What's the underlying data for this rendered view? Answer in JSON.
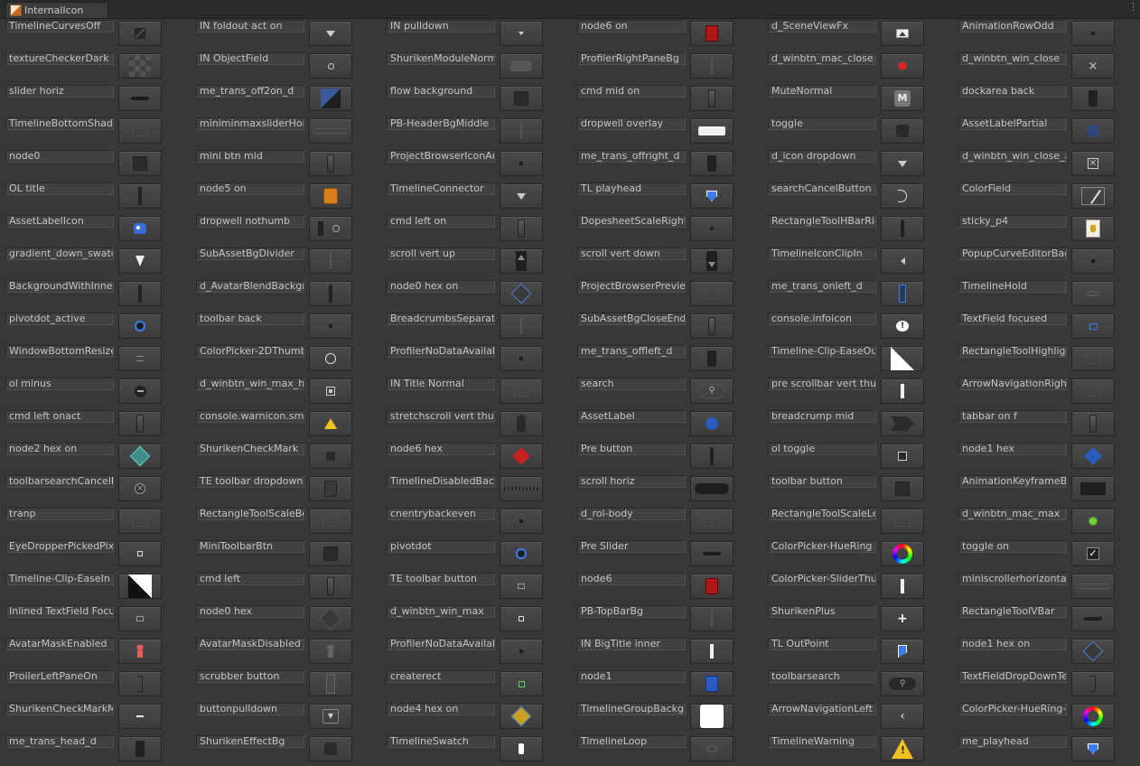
{
  "window": {
    "tab_label": "InternalIcon"
  },
  "grid": {
    "columns": [
      {
        "cells": [
          {
            "label": "TimelineCurvesOff",
            "icon": "curves-off-icon"
          },
          {
            "label": "textureCheckerDark",
            "icon": "checker-icon"
          },
          {
            "label": "slider horiz",
            "icon": "slider-horiz-icon"
          },
          {
            "label": "TimelineBottomShadow",
            "icon": "faint-icon"
          },
          {
            "label": "node0",
            "icon": "dark-square-icon"
          },
          {
            "label": "OL title",
            "icon": "thin-bar-icon"
          },
          {
            "label": "AssetLabelIcon",
            "icon": "tag-icon"
          },
          {
            "label": "gradient_down_swatch",
            "icon": "swatch-down-icon"
          },
          {
            "label": "BackgroundWithInnerShadow",
            "icon": "thin-bar-icon"
          },
          {
            "label": "pivotdot_active",
            "icon": "blue-circle-icon"
          },
          {
            "label": "WindowBottomResize",
            "icon": "resize-icon"
          },
          {
            "label": "ol minus",
            "icon": "minus-circle-icon"
          },
          {
            "label": "cmd left onact",
            "icon": "cmd-icon"
          },
          {
            "label": "node2 hex on",
            "icon": "teal-hex-icon"
          },
          {
            "label": "toolbarsearchCancelButton",
            "icon": "cancel-circle-icon"
          },
          {
            "label": "tranp",
            "icon": "faint-icon"
          },
          {
            "label": "EyeDropperPickedPixel",
            "icon": "small-square-outline-icon"
          },
          {
            "label": "Timeline-Clip-EaseIn",
            "icon": "ease-in-icon"
          },
          {
            "label": "Inlined TextField Focus",
            "icon": "small-rect-icon"
          },
          {
            "label": "AvatarMaskEnabled",
            "icon": "avatar-red-icon"
          },
          {
            "label": "ProilerLeftPaneOn",
            "icon": "bracket-icon"
          },
          {
            "label": "ShurikenCheckMarkMixed",
            "icon": "check-mixed-icon"
          },
          {
            "label": "me_trans_head_d",
            "icon": "dark-bar-icon"
          }
        ]
      },
      {
        "cells": [
          {
            "label": "IN foldout act on",
            "icon": "triangle-down-icon"
          },
          {
            "label": "IN ObjectField",
            "icon": "target-icon"
          },
          {
            "label": "me_trans_off2on_d",
            "icon": "trans-blue-icon"
          },
          {
            "label": "miniminmaxsliderHorizontal",
            "icon": "minmax-icon"
          },
          {
            "label": "mini btn mid",
            "icon": "cmd-icon"
          },
          {
            "label": "node5 on",
            "icon": "orange-node-icon"
          },
          {
            "label": "dropwell nothumb",
            "icon": "dropwell-icon"
          },
          {
            "label": "SubAssetBgDivider",
            "icon": "divider-icon"
          },
          {
            "label": "d_AvatarBlendBackground",
            "icon": "thin-bar-icon"
          },
          {
            "label": "toolbar back",
            "icon": "tiny-dot-icon"
          },
          {
            "label": "ColorPicker-2DThumb",
            "icon": "ring-icon"
          },
          {
            "label": "d_winbtn_win_max_h",
            "icon": "win-max-icon"
          },
          {
            "label": "console.warnicon.sml",
            "icon": "warning-small-icon"
          },
          {
            "label": "ShurikenCheckMark",
            "icon": "dark-dot-icon"
          },
          {
            "label": "TE toolbar dropdown",
            "icon": "dropdown-small-icon"
          },
          {
            "label": "RectangleToolScaleBottom",
            "icon": "faint-icon"
          },
          {
            "label": "MiniToolbarBtn",
            "icon": "dark-square-icon"
          },
          {
            "label": "cmd left",
            "icon": "cmd-icon"
          },
          {
            "label": "node0 hex",
            "icon": "grey-hex-icon"
          },
          {
            "label": "AvatarMaskDisabled",
            "icon": "avatar-grey-icon"
          },
          {
            "label": "scrubber button",
            "icon": "scrubber-icon"
          },
          {
            "label": "buttonpulldown",
            "icon": "pulldown-icon"
          },
          {
            "label": "ShurikenEffectBg",
            "icon": "dark-rounded-icon"
          }
        ]
      },
      {
        "cells": [
          {
            "label": "IN pulldown",
            "icon": "small-triangle-icon"
          },
          {
            "label": "ShurikenModuleNormal",
            "icon": "module-icon"
          },
          {
            "label": "flow background",
            "icon": "dark-square-icon"
          },
          {
            "label": "PB-HeaderBgMiddle",
            "icon": "divider-icon"
          },
          {
            "label": "ProjectBrowserIconAreaBg",
            "icon": "tiny-dot-icon"
          },
          {
            "label": "TimelineConnector",
            "icon": "triangle-down-icon"
          },
          {
            "label": "cmd left on",
            "icon": "cmd-icon"
          },
          {
            "label": "scroll vert up",
            "icon": "scroll-up-icon"
          },
          {
            "label": "node0 hex on",
            "icon": "blue-outline-hex-icon"
          },
          {
            "label": "BreadcrumbsSeparator",
            "icon": "divider-icon"
          },
          {
            "label": "ProfilerNoDataAvailable",
            "icon": "tiny-dot-icon"
          },
          {
            "label": "IN Title Normal",
            "icon": "faint-icon"
          },
          {
            "label": "stretchscroll vert thumb",
            "icon": "scroll-thumb-icon"
          },
          {
            "label": "node6 hex",
            "icon": "red-hex-icon"
          },
          {
            "label": "TimelineDisabledBackground",
            "icon": "hatched-icon"
          },
          {
            "label": "cnentrybackeven",
            "icon": "tiny-dot-icon"
          },
          {
            "label": "pivotdot",
            "icon": "blue-circle-icon"
          },
          {
            "label": "TE toolbar button",
            "icon": "small-rect-icon"
          },
          {
            "label": "d_winbtn_win_max",
            "icon": "small-square-outline-icon"
          },
          {
            "label": "ProfilerNoDataAvailable",
            "icon": "tiny-dot-icon"
          },
          {
            "label": "createrect",
            "icon": "green-square-icon"
          },
          {
            "label": "node4 hex on",
            "icon": "yellow-hex-icon"
          },
          {
            "label": "TimelineSwatch",
            "icon": "white-bar-icon"
          }
        ]
      },
      {
        "cells": [
          {
            "label": "node6 on",
            "icon": "red-node-icon"
          },
          {
            "label": "ProfilerRightPaneBg",
            "icon": "divider-icon"
          },
          {
            "label": "cmd mid on",
            "icon": "cmd-icon"
          },
          {
            "label": "dropwell overlay",
            "icon": "white-rect-icon"
          },
          {
            "label": "me_trans_offright_d",
            "icon": "dark-bar-icon"
          },
          {
            "label": "TL playhead",
            "icon": "playhead-icon"
          },
          {
            "label": "DopesheetScaleRight",
            "icon": "tiny-dot-icon"
          },
          {
            "label": "scroll vert down",
            "icon": "scroll-down-icon"
          },
          {
            "label": "ProjectBrowserPreviewBg",
            "icon": "faint-icon"
          },
          {
            "label": "SubAssetBgCloseEnd",
            "icon": "cmd-icon"
          },
          {
            "label": "me_trans_offleft_d",
            "icon": "dark-bar-icon"
          },
          {
            "label": "search",
            "icon": "search-icon"
          },
          {
            "label": "AssetLabel",
            "icon": "blue-circle-fill-icon"
          },
          {
            "label": "Pre button",
            "icon": "thin-bar-icon"
          },
          {
            "label": "scroll horiz",
            "icon": "scroll-horiz-icon"
          },
          {
            "label": "d_rol-body",
            "icon": "faint-icon"
          },
          {
            "label": "Pre Slider",
            "icon": "slider-horiz-icon"
          },
          {
            "label": "node6",
            "icon": "red-node-icon"
          },
          {
            "label": "PB-TopBarBg",
            "icon": "divider-icon"
          },
          {
            "label": "IN BigTitle inner",
            "icon": "white-line-icon"
          },
          {
            "label": "node1",
            "icon": "blue-node-icon"
          },
          {
            "label": "TimelineGroupBackground",
            "icon": "white-square-icon"
          },
          {
            "label": "TimelineLoop",
            "icon": "loop-icon"
          }
        ]
      },
      {
        "cells": [
          {
            "label": "d_SceneViewFx",
            "icon": "image-icon"
          },
          {
            "label": "d_winbtn_mac_close",
            "icon": "red-dot-icon"
          },
          {
            "label": "MuteNormal",
            "icon": "mute-icon"
          },
          {
            "label": "toggle",
            "icon": "dark-rounded-icon"
          },
          {
            "label": "d_icon dropdown",
            "icon": "triangle-down-icon"
          },
          {
            "label": "searchCancelButton",
            "icon": "cancel-half-icon"
          },
          {
            "label": "RectangleToolHBarRight",
            "icon": "thin-bar-icon"
          },
          {
            "label": "TimelineIconClipIn",
            "icon": "clip-in-icon"
          },
          {
            "label": "me_trans_onleft_d",
            "icon": "blue-bar-icon"
          },
          {
            "label": "console.infoicon",
            "icon": "info-bubble-icon"
          },
          {
            "label": "Timeline-Clip-EaseOut",
            "icon": "ease-out-icon"
          },
          {
            "label": "pre scrollbar vert thumb",
            "icon": "white-line-icon"
          },
          {
            "label": "breadcrump mid",
            "icon": "breadcrumb-icon"
          },
          {
            "label": "ol toggle",
            "icon": "checkbox-icon"
          },
          {
            "label": "toolbar button",
            "icon": "dark-square-icon"
          },
          {
            "label": "RectangleToolScaleLeft",
            "icon": "faint-icon"
          },
          {
            "label": "ColorPicker-HueRing",
            "icon": "hue-ring-icon"
          },
          {
            "label": "ColorPicker-SliderThumb",
            "icon": "white-line-icon"
          },
          {
            "label": "ShurikenPlus",
            "icon": "plus-icon"
          },
          {
            "label": "TL OutPoint",
            "icon": "outpoint-icon"
          },
          {
            "label": "toolbarsearch",
            "icon": "search-field-icon"
          },
          {
            "label": "ArrowNavigationLeft",
            "icon": "arrow-left-icon"
          },
          {
            "label": "TimelineWarning",
            "icon": "warning-big-icon"
          }
        ]
      },
      {
        "cells": [
          {
            "label": "AnimationRowOdd",
            "icon": "tiny-dot-icon"
          },
          {
            "label": "d_winbtn_win_close",
            "icon": "close-x-icon"
          },
          {
            "label": "dockarea back",
            "icon": "dark-bar-icon"
          },
          {
            "label": "AssetLabelPartial",
            "icon": "blue-dim-circle-icon"
          },
          {
            "label": "d_winbtn_win_close_a",
            "icon": "close-box-icon"
          },
          {
            "label": "ColorField",
            "icon": "color-field-icon"
          },
          {
            "label": "sticky_p4",
            "icon": "sticky-icon"
          },
          {
            "label": "PopupCurveEditorBackground",
            "icon": "tiny-dot-icon"
          },
          {
            "label": "TimelineHold",
            "icon": "hold-icon"
          },
          {
            "label": "TextField focused",
            "icon": "blue-rect-outline-icon"
          },
          {
            "label": "RectangleToolHighlight",
            "icon": "faint-icon"
          },
          {
            "label": "ArrowNavigationRight",
            "icon": "arrow-right-icon"
          },
          {
            "label": "tabbar on f",
            "icon": "cmd-icon"
          },
          {
            "label": "node1 hex",
            "icon": "blue-hex-icon"
          },
          {
            "label": "AnimationKeyframeBackground",
            "icon": "dark-wide-icon"
          },
          {
            "label": "d_winbtn_mac_max",
            "icon": "green-dot-icon"
          },
          {
            "label": "toggle on",
            "icon": "checkbox-checked-icon"
          },
          {
            "label": "miniscrollerhorizontalbg",
            "icon": "minmax-icon"
          },
          {
            "label": "RectangleToolVBar",
            "icon": "slider-horiz-icon"
          },
          {
            "label": "node1 hex on",
            "icon": "blue-outline-hex-icon"
          },
          {
            "label": "TextFieldDropDownText",
            "icon": "bracket-icon"
          },
          {
            "label": "ColorPicker-HueRing-Thumb",
            "icon": "hue-ring-icon"
          },
          {
            "label": "me_playhead",
            "icon": "playhead-icon"
          }
        ]
      }
    ]
  }
}
